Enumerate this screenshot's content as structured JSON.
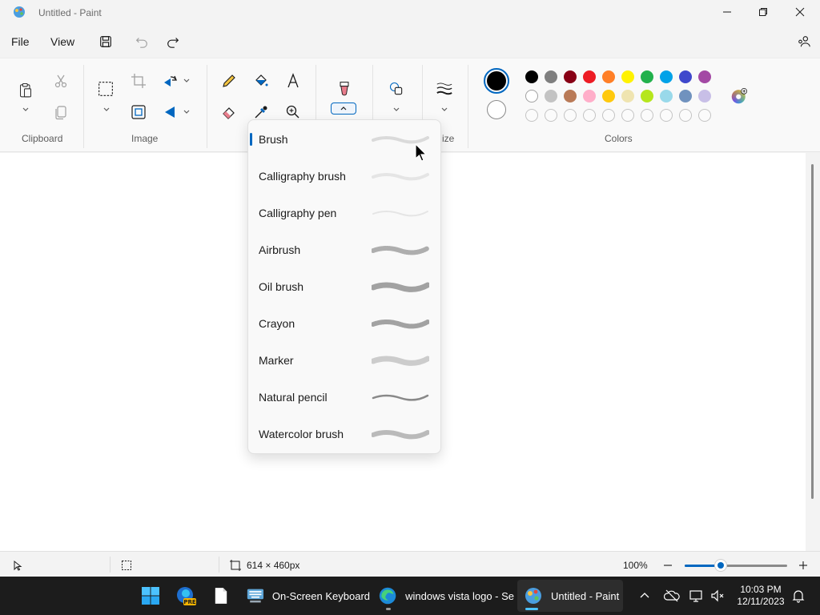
{
  "window": {
    "title": "Untitled - Paint"
  },
  "menu": {
    "file": "File",
    "view": "View"
  },
  "ribbon": {
    "groups": {
      "clipboard": "Clipboard",
      "image": "Image",
      "size_fragment": "ize",
      "colors": "Colors"
    },
    "current_colors": {
      "primary": "#000000",
      "secondary": "#ffffff"
    },
    "palette_row1": [
      "#000000",
      "#7f7f7f",
      "#880015",
      "#ed1c24",
      "#ff7f27",
      "#fff200",
      "#22b14c",
      "#00a2e8",
      "#3f48cc",
      "#a349a4"
    ],
    "palette_row2": [
      "#ffffff",
      "#c3c3c3",
      "#b97a57",
      "#ffaec9",
      "#ffc90e",
      "#efe4b0",
      "#b5e61d",
      "#99d9ea",
      "#7092be",
      "#c8bfe7"
    ]
  },
  "brush_menu": {
    "selected": "Brush",
    "items": [
      {
        "label": "Brush"
      },
      {
        "label": "Calligraphy brush"
      },
      {
        "label": "Calligraphy pen"
      },
      {
        "label": "Airbrush"
      },
      {
        "label": "Oil brush"
      },
      {
        "label": "Crayon"
      },
      {
        "label": "Marker"
      },
      {
        "label": "Natural pencil"
      },
      {
        "label": "Watercolor brush"
      }
    ]
  },
  "status": {
    "canvas_size": "614 × 460px",
    "zoom": "100%",
    "zoom_level": 0.35
  },
  "taskbar": {
    "apps": [
      {
        "label": "On-Screen Keyboard"
      },
      {
        "label": "windows vista logo - Se"
      },
      {
        "label": "Untitled - Paint"
      }
    ],
    "edge_badge": "PRE",
    "time": "10:03 PM",
    "date": "12/11/2023"
  }
}
